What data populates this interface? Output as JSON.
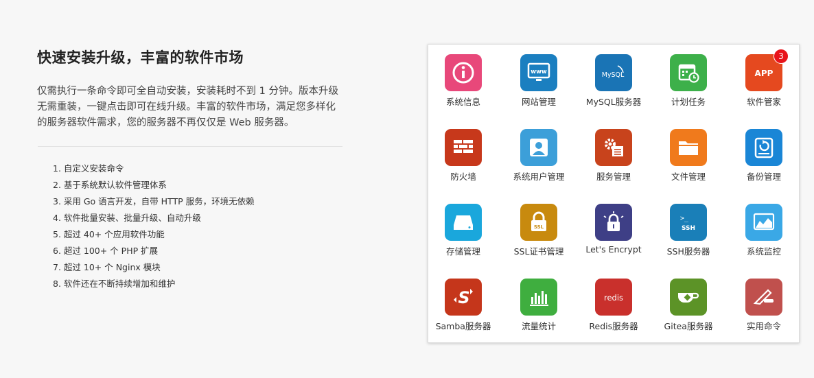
{
  "heading": "快速安装升级，丰富的软件市场",
  "description": "仅需执行一条命令即可全自动安装，安装耗时不到 1 分钟。版本升级无需重装，一键点击即可在线升级。丰富的软件市场，满足您多样化的服务器软件需求，您的服务器不再仅仅是 Web 服务器。",
  "features": [
    "1. 自定义安装命令",
    "2. 基于系统默认软件管理体系",
    "3. 采用 Go 语言开发，自带 HTTP 服务，环境无依赖",
    "4. 软件批量安装、批量升级、自动升级",
    "5. 超过 40+ 个应用软件功能",
    "6. 超过 100+ 个 PHP 扩展",
    "7. 超过 10+ 个 Nginx 模块",
    "8. 软件还在不断持续增加和维护"
  ],
  "apps": [
    {
      "label": "系统信息",
      "icon": "info-icon",
      "color": "#e8487a"
    },
    {
      "label": "网站管理",
      "icon": "www-monitor-icon",
      "color": "#1b7fc0",
      "icon_text": "www"
    },
    {
      "label": "MySQL服务器",
      "icon": "mysql-icon",
      "color": "#1a74b5",
      "icon_text": "MySQL"
    },
    {
      "label": "计划任务",
      "icon": "calendar-clock-icon",
      "color": "#3db04a"
    },
    {
      "label": "软件管家",
      "icon": "app-icon",
      "color": "#e5491f",
      "icon_text": "APP",
      "badge": "3"
    },
    {
      "label": "防火墙",
      "icon": "brick-wall-icon",
      "color": "#c7381b"
    },
    {
      "label": "系统用户管理",
      "icon": "user-icon",
      "color": "#3c9fd9"
    },
    {
      "label": "服务管理",
      "icon": "gear-list-icon",
      "color": "#c8431c"
    },
    {
      "label": "文件管理",
      "icon": "folder-icon",
      "color": "#f07a1c"
    },
    {
      "label": "备份管理",
      "icon": "backup-disk-icon",
      "color": "#1a86d6"
    },
    {
      "label": "存储管理",
      "icon": "storage-drive-icon",
      "color": "#1aa7dc"
    },
    {
      "label": "SSL证书管理",
      "icon": "ssl-lock-icon",
      "color": "#c88a0e",
      "icon_text": "SSL"
    },
    {
      "label": "Let's Encrypt",
      "icon": "lock-shine-icon",
      "color": "#3e3f86"
    },
    {
      "label": "SSH服务器",
      "icon": "ssh-terminal-icon",
      "color": "#1a7fb8",
      "icon_text": "SSH"
    },
    {
      "label": "系统监控",
      "icon": "monitor-chart-icon",
      "color": "#3aa8e6"
    },
    {
      "label": "Samba服务器",
      "icon": "samba-icon",
      "color": "#c5361b"
    },
    {
      "label": "流量统计",
      "icon": "bar-chart-icon",
      "color": "#3fae3f"
    },
    {
      "label": "Redis服务器",
      "icon": "redis-icon",
      "color": "#c9302c",
      "icon_text": "redis"
    },
    {
      "label": "Gitea服务器",
      "icon": "gitea-teacup-icon",
      "color": "#5c9327"
    },
    {
      "label": "实用命令",
      "icon": "knife-tool-icon",
      "color": "#c0504d"
    }
  ]
}
